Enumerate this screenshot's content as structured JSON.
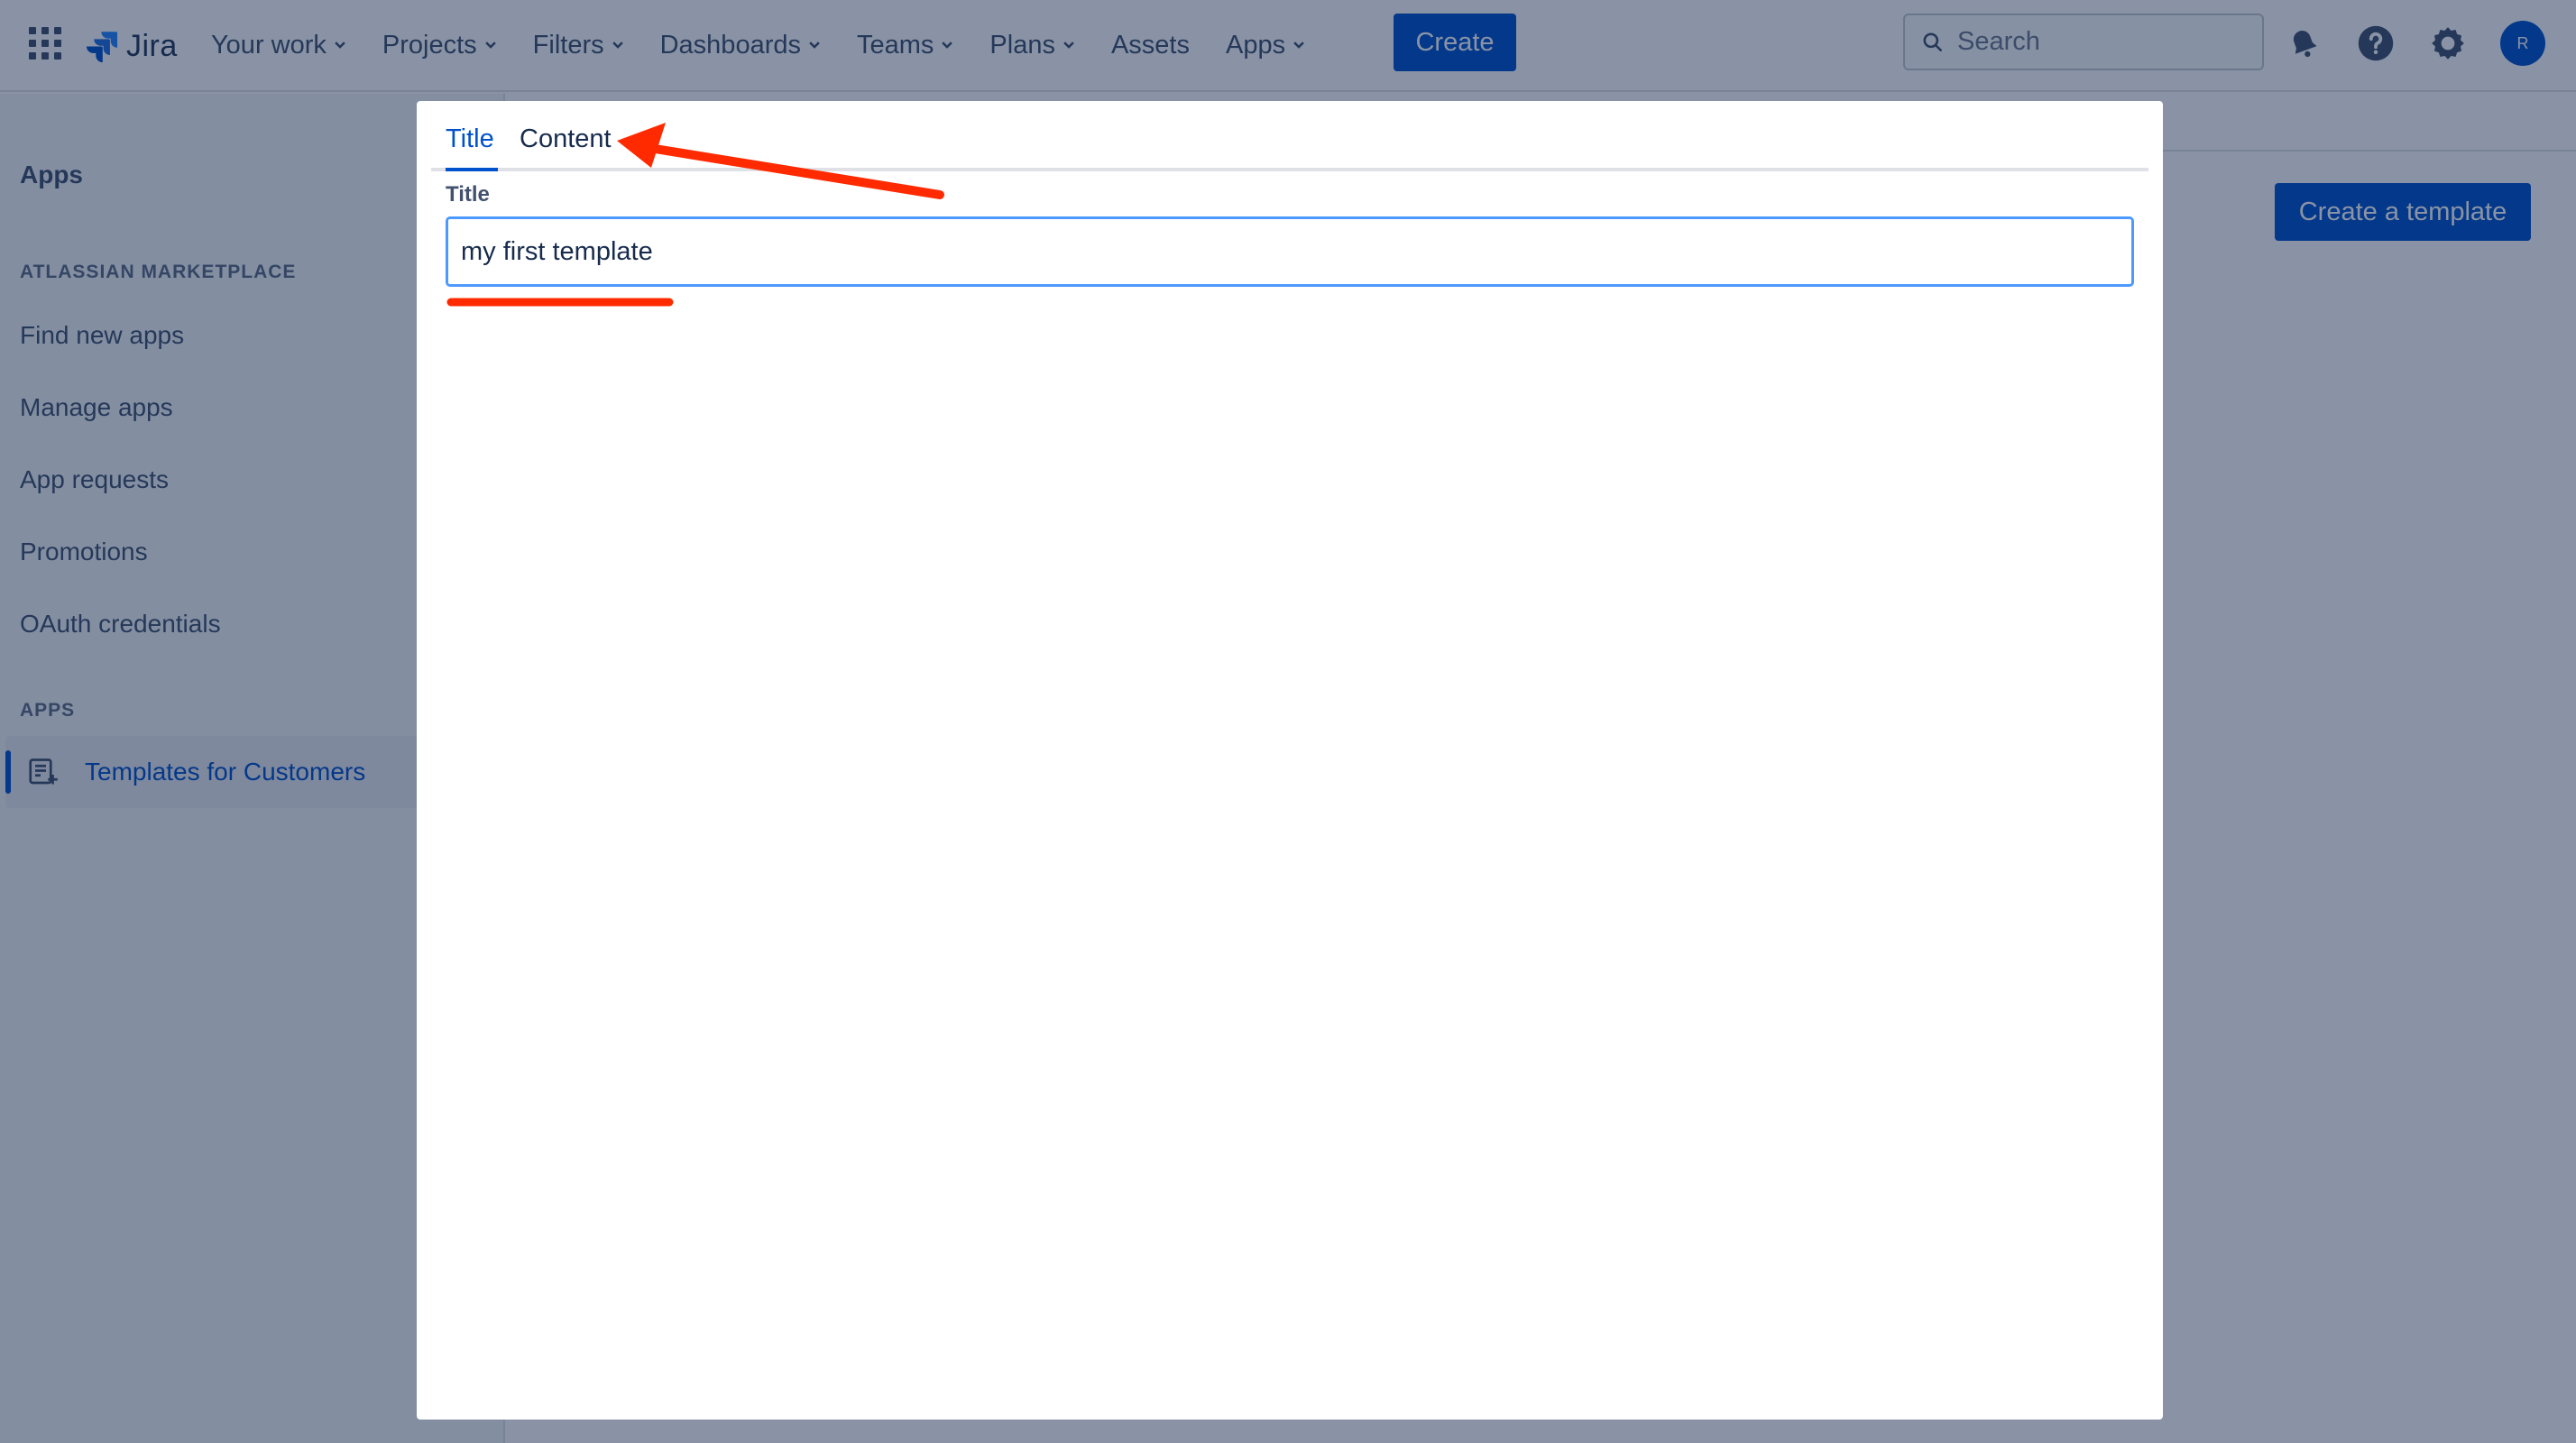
{
  "topnav": {
    "logo_text": "Jira",
    "nav_items": [
      {
        "label": "Your work",
        "has_dropdown": true
      },
      {
        "label": "Projects",
        "has_dropdown": true
      },
      {
        "label": "Filters",
        "has_dropdown": true
      },
      {
        "label": "Dashboards",
        "has_dropdown": true
      },
      {
        "label": "Teams",
        "has_dropdown": true
      },
      {
        "label": "Plans",
        "has_dropdown": true
      },
      {
        "label": "Assets",
        "has_dropdown": false
      },
      {
        "label": "Apps",
        "has_dropdown": true
      }
    ],
    "create_label": "Create",
    "search_placeholder": "Search",
    "avatar_initial": "R",
    "icons": [
      "app-switcher-icon",
      "jira-logo-icon",
      "search-icon",
      "notifications-icon",
      "help-icon",
      "settings-icon"
    ]
  },
  "sidebar": {
    "title": "Apps",
    "marketplace_section": "ATLASSIAN MARKETPLACE",
    "marketplace_items": [
      "Find new apps",
      "Manage apps",
      "App requests",
      "Promotions",
      "OAuth credentials"
    ],
    "apps_section": "APPS",
    "active_item": "Templates for Customers"
  },
  "main": {
    "create_template_label": "Create a template"
  },
  "modal": {
    "tabs": [
      {
        "label": "Title",
        "active": true
      },
      {
        "label": "Content",
        "active": false
      }
    ],
    "field_label": "Title",
    "title_value": "my first template"
  },
  "colors": {
    "primary": "#0052CC",
    "annotation": "#FF2A00",
    "overlay": "rgba(9,30,66,0.48)"
  }
}
